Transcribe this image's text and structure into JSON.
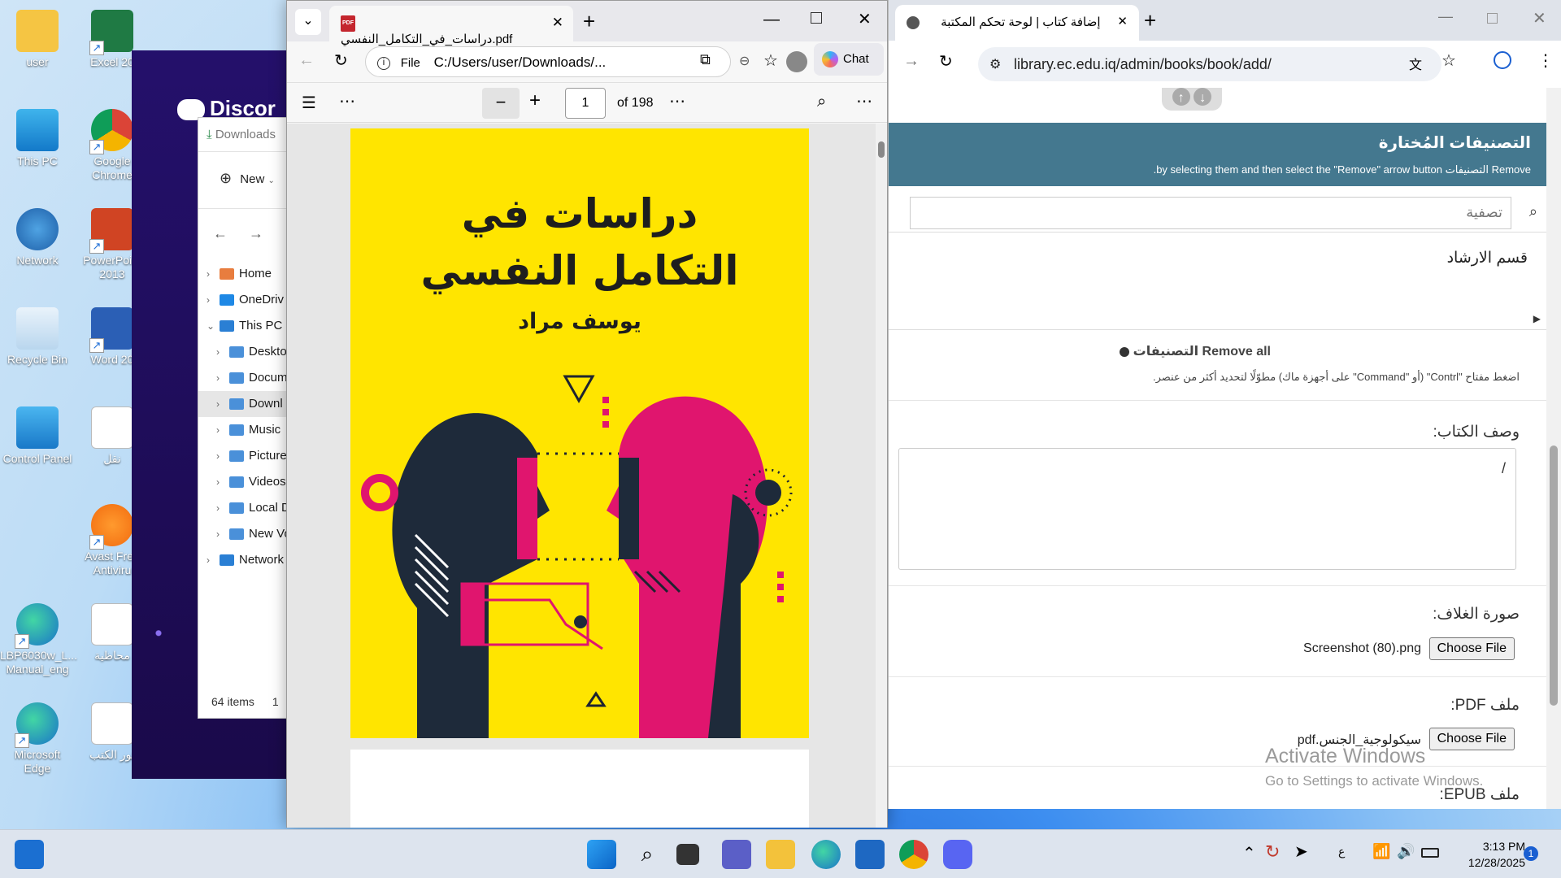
{
  "desktop": {
    "icons_col1": [
      "user",
      "This PC",
      "Network",
      "Recycle Bin",
      "Control Panel",
      "LBP6030w_L...\nManual_eng",
      "Microsoft Edge"
    ],
    "icons_col2": [
      "Excel 20",
      "Google Chrome",
      "PowerPoint 2013",
      "Word 20",
      "نقل",
      "Avast Free Antiviru",
      "محاظية",
      "تور الكتب"
    ]
  },
  "discord": {
    "brand": "Discor"
  },
  "explorer": {
    "breadcrumb": "Downloads",
    "new_label": "New",
    "tree": [
      {
        "label": "Home",
        "level": 0
      },
      {
        "label": "OneDriv",
        "level": 0
      },
      {
        "label": "This PC",
        "level": 0,
        "expanded": true
      },
      {
        "label": "Deskto",
        "level": 1
      },
      {
        "label": "Docum",
        "level": 1
      },
      {
        "label": "Downl",
        "level": 1,
        "selected": true
      },
      {
        "label": "Music",
        "level": 1
      },
      {
        "label": "Picture",
        "level": 1
      },
      {
        "label": "Videos",
        "level": 1
      },
      {
        "label": "Local D",
        "level": 1
      },
      {
        "label": "New Vo",
        "level": 1
      },
      {
        "label": "Network",
        "level": 0
      }
    ],
    "status": "64 items",
    "status_extra": "1"
  },
  "edge": {
    "tab_title": "دراسات_في_التكامل_النفسي.pdf",
    "url_prefix": "File",
    "url": "C:/Users/user/Downloads/...",
    "chat_label": "Chat",
    "page_current": "1",
    "page_total": "of 198",
    "cover": {
      "title_line1": "دراسات في",
      "title_line2": "التكامل النفسي",
      "author": "يوسف مراد"
    }
  },
  "chrome": {
    "tab_title": "إضافة كتاب | لوحة تحكم المكتبة",
    "url": "library.ec.edu.iq/admin/books/book/add/",
    "chosen_header": "التصنيفات المُختارة",
    "chosen_sub": "Remove التصنيفات by selecting them and then select the \"Remove\" arrow button.",
    "filter_placeholder": "تصفية",
    "chosen_option": "قسم الارشاد",
    "remove_all": "Remove all التصنيفات",
    "hint": "اضغط مفتاح \"Contrl\" (أو \"Command\" على أجهزة ماك) مطوّلًا لتحديد أكثر من عنصر.",
    "desc_label": "وصف الكتاب:",
    "desc_value": "/",
    "cover_label": "صورة الغلاف:",
    "cover_file": "Screenshot (80).png",
    "choose_file": "Choose File",
    "pdf_label": "ملف PDF:",
    "pdf_file": "سيكولوجية_الجنس.pdf",
    "epub_label": "ملف EPUB:",
    "activate_1": "Activate Windows",
    "activate_2": "Go to Settings to activate Windows."
  },
  "taskbar": {
    "time": "3:13 PM",
    "date": "12/28/2025",
    "lang": "ع",
    "notif_count": "1"
  }
}
